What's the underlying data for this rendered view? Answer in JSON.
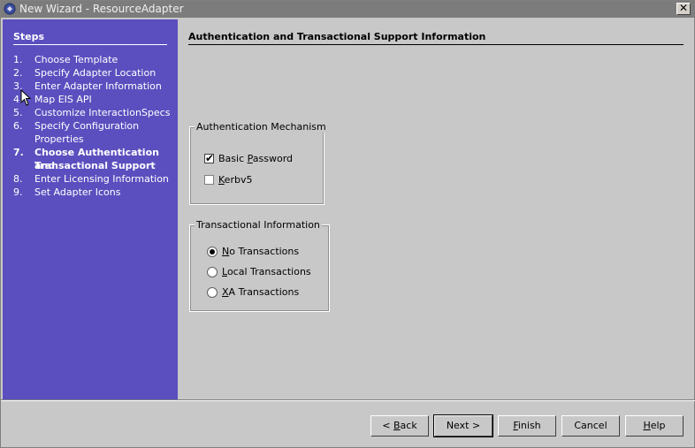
{
  "window": {
    "title": "New Wizard - ResourceAdapter",
    "close_glyph": "✕"
  },
  "steps": {
    "heading": "Steps",
    "items": [
      {
        "num": "1.",
        "label": "Choose Template"
      },
      {
        "num": "2.",
        "label": "Specify Adapter Location"
      },
      {
        "num": "3.",
        "label": "Enter Adapter Information"
      },
      {
        "num": "4.",
        "label": "Map EIS API"
      },
      {
        "num": "5.",
        "label": "Customize InteractionSpecs"
      },
      {
        "num": "6.",
        "label": "Specify Configuration",
        "label2": "Properties"
      },
      {
        "num": "7.",
        "label": "Choose Authentication and",
        "label2": "Transactional Support",
        "current": true
      },
      {
        "num": "8.",
        "label": "Enter Licensing Information"
      },
      {
        "num": "9.",
        "label": "Set Adapter Icons"
      }
    ]
  },
  "content": {
    "title": "Authentication and Transactional Support Information",
    "auth": {
      "legend": "Authentication Mechanism",
      "options": [
        {
          "pre": "Basic ",
          "mn": "P",
          "post": "assword",
          "checked": true
        },
        {
          "pre": "",
          "mn": "K",
          "post": "erbv5",
          "checked": false
        }
      ]
    },
    "trans": {
      "legend": "Transactional Information",
      "options": [
        {
          "pre": "",
          "mn": "N",
          "post": "o Transactions",
          "selected": true
        },
        {
          "pre": "",
          "mn": "L",
          "post": "ocal Transactions",
          "selected": false
        },
        {
          "pre": "",
          "mn": "X",
          "post": "A Transactions",
          "selected": false
        }
      ]
    }
  },
  "buttons": {
    "back": {
      "pre": "< ",
      "mn": "B",
      "post": "ack"
    },
    "next": {
      "label": "Next >"
    },
    "finish": {
      "pre": "",
      "mn": "F",
      "post": "inish"
    },
    "cancel": {
      "label": "Cancel"
    },
    "help": {
      "pre": "",
      "mn": "H",
      "post": "elp"
    }
  },
  "colors": {
    "steps_panel": "#5b4fbf",
    "dialog_bg": "#c8c8c8",
    "titlebar": "#7c7c7c"
  }
}
